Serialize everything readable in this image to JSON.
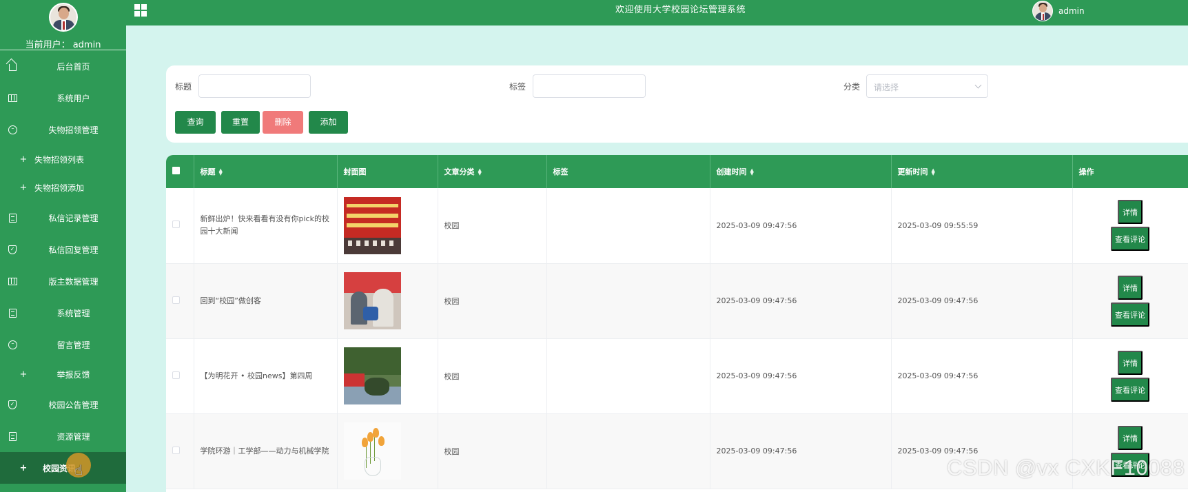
{
  "app": {
    "title": "欢迎使用大学校园论坛管理系统",
    "current_user_label": "当前用户：  admin",
    "header_user": "admin"
  },
  "sidebar": {
    "items": [
      {
        "label": "后台首页",
        "icon": "home-icon",
        "type": "main"
      },
      {
        "label": "系统用户",
        "icon": "grid-icon",
        "type": "main"
      },
      {
        "label": "失物招领管理",
        "icon": "chat-icon",
        "type": "main"
      },
      {
        "label": "失物招领列表",
        "icon": "plus-icon",
        "type": "sub"
      },
      {
        "label": "失物招领添加",
        "icon": "plus-icon",
        "type": "sub"
      },
      {
        "label": "私信记录管理",
        "icon": "document-icon",
        "type": "main"
      },
      {
        "label": "私信回复管理",
        "icon": "shield-check-icon",
        "type": "main"
      },
      {
        "label": "版主数据管理",
        "icon": "grid-icon",
        "type": "main"
      },
      {
        "label": "系统管理",
        "icon": "document-icon",
        "type": "main"
      },
      {
        "label": "留言管理",
        "icon": "chat-icon",
        "type": "main"
      },
      {
        "label": "举报反馈",
        "icon": "plus-icon",
        "type": "sub"
      },
      {
        "label": "校园公告管理",
        "icon": "shield-check-icon",
        "type": "main"
      },
      {
        "label": "资源管理",
        "icon": "document-icon",
        "type": "main"
      },
      {
        "label": "校园资讯",
        "icon": "plus-icon",
        "type": "active"
      }
    ]
  },
  "search": {
    "title_label": "标题",
    "tag_label": "标签",
    "category_label": "分类",
    "category_placeholder": "请选择",
    "query_button": "查询",
    "reset_button": "重置",
    "delete_button": "删除",
    "add_button": "添加"
  },
  "table": {
    "columns": [
      "标题",
      "封面图",
      "文章分类",
      "标签",
      "创建时间",
      "更新时间",
      "操作"
    ],
    "detail_label": "详情",
    "comment_label": "查看评论",
    "rows": [
      {
        "title": "新鲜出炉！快来看看有没有你pick的校园十大新闻",
        "category": "校园",
        "tag": "",
        "created": "2025-03-09 09:47:56",
        "updated": "2025-03-09 09:55:59"
      },
      {
        "title": "回到“校园”做创客",
        "category": "校园",
        "tag": "",
        "created": "2025-03-09 09:47:56",
        "updated": "2025-03-09 09:47:56"
      },
      {
        "title": "【为明花开 • 校园news】第四周",
        "category": "校园",
        "tag": "",
        "created": "2025-03-09 09:47:56",
        "updated": "2025-03-09 09:47:56"
      },
      {
        "title": "学院环游｜工学部——动力与机械学院",
        "category": "校园",
        "tag": "",
        "created": "2025-03-09 09:47:56",
        "updated": "2025-03-09 09:47:56"
      }
    ]
  },
  "watermark": "CSDN @vx  CXKF10088"
}
